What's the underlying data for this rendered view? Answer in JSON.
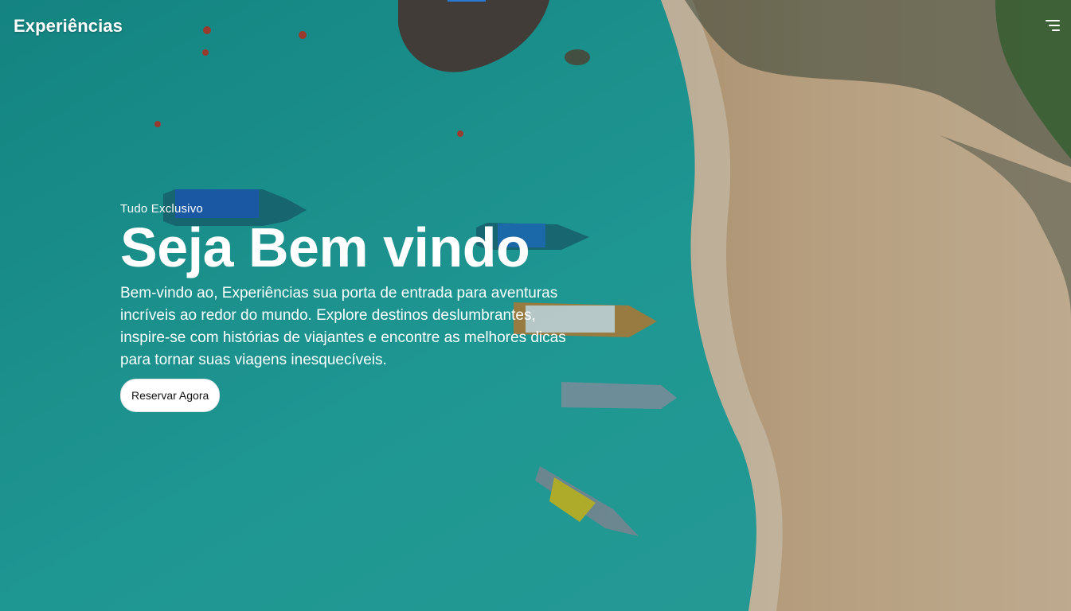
{
  "brand": {
    "name": "Experiências"
  },
  "menu": {
    "icon": "hamburger-menu-icon"
  },
  "hero": {
    "eyebrow": "Tudo Exclusivo",
    "title": "Seja Bem vindo",
    "description": "Bem-vindo ao, Experiências sua porta de entrada para aventuras incríveis ao redor do mundo. Explore destinos deslumbrantes, inspire-se com histórias de viajantes e encontre as melhores dicas para tornar suas viagens inesquecíveis.",
    "cta_label": "Reservar Agora"
  },
  "colors": {
    "water": "#1faaa6",
    "sand": "#cfb58f",
    "text": "#ffffff",
    "accent": "#2a7bd6",
    "button_bg": "#ffffff",
    "button_text": "#111111"
  }
}
